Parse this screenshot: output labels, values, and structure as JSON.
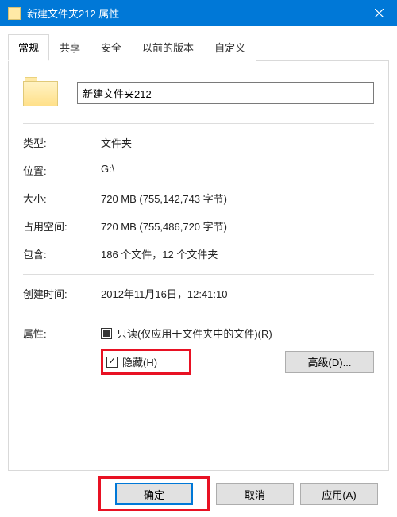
{
  "window": {
    "title": "新建文件夹212 属性"
  },
  "tabs": {
    "general": "常规",
    "sharing": "共享",
    "security": "安全",
    "previous": "以前的版本",
    "customize": "自定义"
  },
  "folder": {
    "name": "新建文件夹212"
  },
  "labels": {
    "type": "类型:",
    "location": "位置:",
    "size": "大小:",
    "size_on_disk": "占用空间:",
    "contains": "包含:",
    "created": "创建时间:",
    "attributes": "属性:"
  },
  "values": {
    "type": "文件夹",
    "location": "G:\\",
    "size": "720 MB (755,142,743 字节)",
    "size_on_disk": "720 MB (755,486,720 字节)",
    "contains": "186 个文件，12 个文件夹",
    "created": "2012年11月16日，12:41:10"
  },
  "attributes": {
    "readonly_label": "只读(仅应用于文件夹中的文件)(R)",
    "hidden_label": "隐藏(H)",
    "advanced_button": "高级(D)..."
  },
  "buttons": {
    "ok": "确定",
    "cancel": "取消",
    "apply": "应用(A)"
  }
}
